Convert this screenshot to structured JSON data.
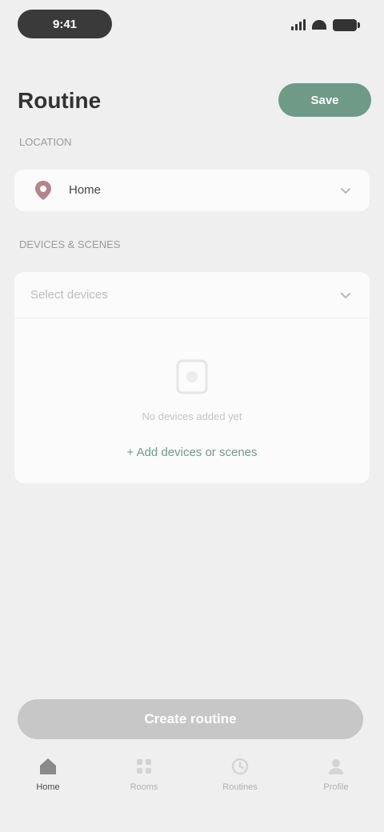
{
  "status_bar": {
    "time": "9:41"
  },
  "header": {
    "title": "Routine",
    "action_label": "Save"
  },
  "location_section": {
    "label": "LOCATION",
    "value": "Home",
    "icon": "map-pin-icon"
  },
  "devices_section": {
    "label": "DEVICES & SCENES",
    "placeholder": "Select devices",
    "empty_text": "No devices added yet",
    "add_label": "+ Add devices or scenes"
  },
  "footer": {
    "primary_label": "Create routine"
  },
  "tabs": [
    {
      "label": "Home",
      "icon": "home-icon",
      "active": true
    },
    {
      "label": "Rooms",
      "icon": "grid-icon",
      "active": false
    },
    {
      "label": "Routines",
      "icon": "clock-icon",
      "active": false
    },
    {
      "label": "Profile",
      "icon": "user-icon",
      "active": false
    }
  ],
  "colors": {
    "accent": "#6f9a88",
    "background": "#efefef",
    "card": "#fbfbfb",
    "disabled_button": "#c7c7c7",
    "pin": "#b5848c"
  }
}
